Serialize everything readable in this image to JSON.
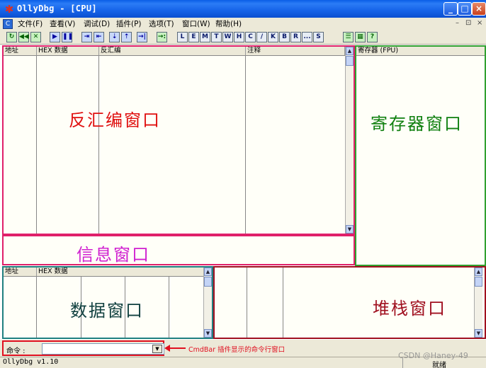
{
  "window": {
    "title": "OllyDbg - [CPU]",
    "controls": {
      "minimize": "_",
      "maximize": "□",
      "close": "×"
    }
  },
  "menu": {
    "items": [
      "文件(F)",
      "查看(V)",
      "调试(D)",
      "插件(P)",
      "选项(T)",
      "窗口(W)",
      "帮助(H)"
    ],
    "mdi_controls": {
      "minimize": "–",
      "restore": "⊡",
      "close": "×"
    }
  },
  "toolbar": {
    "buttons": [
      "↻",
      "◀◀",
      "✕",
      "▶",
      "❚❚",
      "⇥",
      "⇤",
      "⇣",
      "⇡",
      "→|",
      "→:",
      "L",
      "E",
      "M",
      "T",
      "W",
      "H",
      "C",
      "/",
      "K",
      "B",
      "R",
      "...",
      "S",
      "☰",
      "▦",
      "?"
    ]
  },
  "disasm": {
    "columns": [
      "地址",
      "HEX 数据",
      "反汇编",
      "注释"
    ],
    "label": "反汇编窗口",
    "label_color": "#e01010",
    "border_color": "#e0206a"
  },
  "registers": {
    "header": "寄存器 (FPU)",
    "label": "寄存器窗口",
    "label_color": "#108010",
    "border_color": "#30a030"
  },
  "info": {
    "label": "信息窗口",
    "label_color": "#d020d0",
    "border_color": "#e0206a"
  },
  "dump": {
    "columns": [
      "地址",
      "HEX 数据"
    ],
    "label": "数据窗口",
    "label_color": "#104040",
    "border_color": "#208080"
  },
  "stack": {
    "label": "堆栈窗口",
    "label_color": "#a01020",
    "border_color": "#a01020"
  },
  "command": {
    "label": "命令 :",
    "value": "",
    "annotation": "CmdBar 插件显示的命令行窗口"
  },
  "status": {
    "left": "OllyDbg v1.10",
    "right": "就绪"
  },
  "watermark": "CSDN @Haney-49",
  "icons": {
    "app": "bug-icon",
    "dropdown": "chevron-down-icon",
    "scroll_up": "chevron-up-icon",
    "scroll_down": "chevron-down-icon"
  }
}
